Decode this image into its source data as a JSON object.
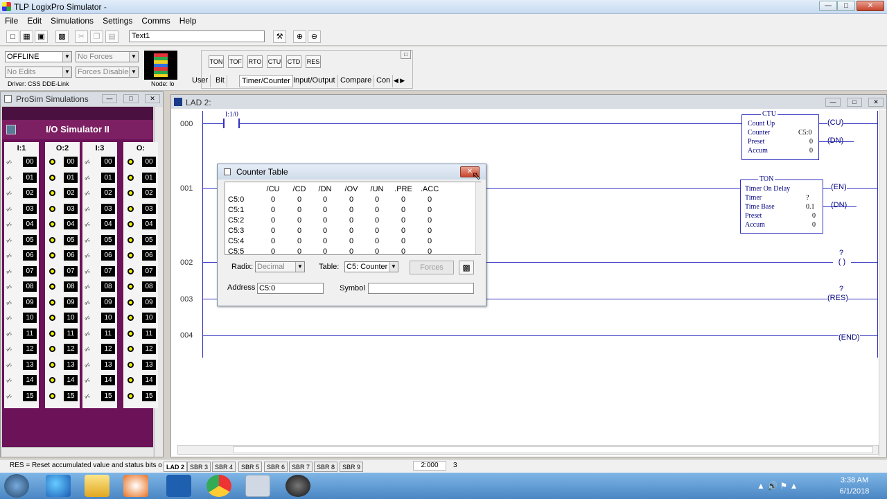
{
  "app": {
    "title": "TLP LogixPro Simulator -"
  },
  "menu": [
    "File",
    "Edit",
    "Simulations",
    "Settings",
    "Comms",
    "Help"
  ],
  "toolbar": {
    "text_field_value": "Text1"
  },
  "status_panel": {
    "mode": "OFFLINE",
    "forces": "No Forces",
    "edits": "No Edits",
    "forces_enabled": "Forces Disabled",
    "driver": "Driver: CSS DDE-Link",
    "node": "Node: lo"
  },
  "instructions": {
    "buttons": [
      "TON",
      "TOF",
      "RTO",
      "CTU",
      "CTD",
      "RES"
    ],
    "tabs": [
      "User",
      "Bit",
      "Timer/Counter",
      "Input/Output",
      "Compare",
      "Con"
    ]
  },
  "prosim": {
    "title": "ProSim Simulations",
    "header": "I/O Simulator II",
    "slots": [
      "I:1",
      "O:2",
      "I:3",
      "O:"
    ],
    "rows": [
      "00",
      "01",
      "02",
      "03",
      "04",
      "05",
      "06",
      "07",
      "08",
      "09",
      "10",
      "11",
      "12",
      "13",
      "14",
      "15"
    ]
  },
  "ladder": {
    "title": "LAD 2:",
    "rungs": [
      "000",
      "001",
      "002",
      "003",
      "004"
    ],
    "contact_label": "I:1/0",
    "ctu": {
      "title": "CTU",
      "desc": "Count Up",
      "counter_label": "Counter",
      "counter_value": "C5:0",
      "preset_label": "Preset",
      "preset_value": "0",
      "accum_label": "Accum",
      "accum_value": "0",
      "cu": "CU",
      "dn": "DN"
    },
    "ton": {
      "title": "TON",
      "desc": "Timer On Delay",
      "timer_label": "Timer",
      "timer_value": "?",
      "base_label": "Time Base",
      "base_value": "0.1",
      "preset_label": "Preset",
      "preset_value": "0",
      "accum_label": "Accum",
      "accum_value": "0",
      "en": "EN",
      "dn": "DN"
    },
    "rung2_coil": "( )",
    "rung2_q": "?",
    "rung3_q": "?",
    "res": "RES",
    "end": "END"
  },
  "dialog": {
    "title": "Counter Table",
    "columns": [
      "/CU",
      "/CD",
      "/DN",
      "/OV",
      "/UN",
      ".PRE",
      ".ACC"
    ],
    "rows": [
      {
        "name": "C5:0",
        "values": [
          "0",
          "0",
          "0",
          "0",
          "0",
          "0",
          "0"
        ]
      },
      {
        "name": "C5:1",
        "values": [
          "0",
          "0",
          "0",
          "0",
          "0",
          "0",
          "0"
        ]
      },
      {
        "name": "C5:2",
        "values": [
          "0",
          "0",
          "0",
          "0",
          "0",
          "0",
          "0"
        ]
      },
      {
        "name": "C5:3",
        "values": [
          "0",
          "0",
          "0",
          "0",
          "0",
          "0",
          "0"
        ]
      },
      {
        "name": "C5:4",
        "values": [
          "0",
          "0",
          "0",
          "0",
          "0",
          "0",
          "0"
        ]
      },
      {
        "name": "C5:5",
        "values": [
          "0",
          "0",
          "0",
          "0",
          "0",
          "0",
          "0"
        ]
      }
    ],
    "radix_label": "Radix:",
    "radix_value": "Decimal",
    "table_label": "Table:",
    "table_value": "C5: Counter",
    "forces_label": "Forces",
    "address_label": "Address",
    "address_value": "C5:0",
    "symbol_label": "Symbol",
    "symbol_value": ""
  },
  "statusbar": {
    "message": "RES = Reset accumulated value and status bits o",
    "tabs": [
      "LAD 2",
      "SBR 3",
      "SBR 4",
      "SBR 5",
      "SBR 6",
      "SBR 7",
      "SBR 8",
      "SBR 9"
    ],
    "pos": "2:000",
    "count": "3"
  },
  "taskbar": {
    "time": "3:38 AM",
    "date": "6/1/2018"
  }
}
